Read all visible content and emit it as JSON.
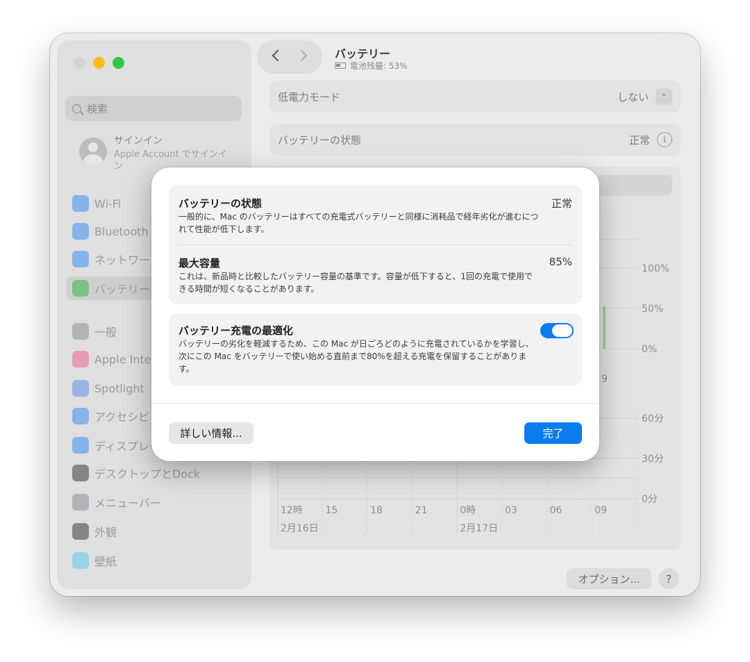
{
  "header": {
    "title": "バッテリー",
    "subtitle": "電池残量: 53%"
  },
  "sidebar": {
    "search_placeholder": "検索",
    "account": {
      "title": "サインイン",
      "subtitle": "Apple Account でサインイン"
    },
    "items": [
      {
        "label": "Wi-Fi",
        "icon": "wifi-icon",
        "color": "#3d8ef0"
      },
      {
        "label": "Bluetooth",
        "icon": "bluetooth-icon",
        "color": "#3d8ef0"
      },
      {
        "label": "ネットワーク",
        "icon": "globe-icon",
        "color": "#3d8ef0"
      },
      {
        "label": "バッテリー",
        "icon": "battery-icon",
        "color": "#39b54a"
      },
      {
        "label": "一般",
        "icon": "gear-icon",
        "color": "#8e8e93"
      },
      {
        "label": "Apple Intelligence",
        "icon": "apple-intelligence-icon",
        "color": "#f06292"
      },
      {
        "label": "Spotlight",
        "icon": "spotlight-icon",
        "color": "#5e8ee6"
      },
      {
        "label": "アクセシビリティ",
        "icon": "accessibility-icon",
        "color": "#3d8ef0"
      },
      {
        "label": "ディスプレイ",
        "icon": "display-icon",
        "color": "#3d8ef0"
      },
      {
        "label": "デスクトップとDock",
        "icon": "dock-icon",
        "color": "#3a3a3c"
      },
      {
        "label": "メニューバー",
        "icon": "menubar-icon",
        "color": "#8e8e93"
      },
      {
        "label": "外観",
        "icon": "appearance-icon",
        "color": "#3a3a3c"
      },
      {
        "label": "壁紙",
        "icon": "wallpaper-icon",
        "color": "#5ec8f0"
      }
    ]
  },
  "settings": {
    "low_power_label": "低電力モード",
    "low_power_value": "しない",
    "health_label": "バッテリーの状態",
    "health_value": "正常"
  },
  "background_chart": {
    "level_ticks": [
      "100%",
      "50%",
      "0%"
    ],
    "usage_ticks": [
      "60分",
      "30分",
      "0分"
    ],
    "hours": [
      "12時",
      "15",
      "18",
      "21",
      "0時",
      "03",
      "06",
      "09"
    ],
    "dates": [
      "2月16日",
      "2月17日"
    ],
    "partial_label": "9"
  },
  "modal": {
    "health_title": "バッテリーの状態",
    "health_value": "正常",
    "health_desc": "一般的に、Mac のバッテリーはすべての充電式バッテリーと同様に消耗品で経年劣化が進むにつれて性能が低下します。",
    "capacity_title": "最大容量",
    "capacity_value": "85%",
    "capacity_desc": "これは、新品時と比較したバッテリー容量の基準です。容量が低下すると、1回の充電で使用できる時間が短くなることがあります。",
    "optimize_title": "バッテリー充電の最適化",
    "optimize_desc": "バッテリーの劣化を軽減するため、この Mac が日ごろどのように充電されているかを学習し、次にこの Mac をバッテリーで使い始める直前まで80%を超える充電を保留することがあります。",
    "optimize_enabled": true,
    "more_info_label": "詳しい情報...",
    "done_label": "完了"
  },
  "footer": {
    "options_label": "オプション...",
    "help_label": "?"
  }
}
